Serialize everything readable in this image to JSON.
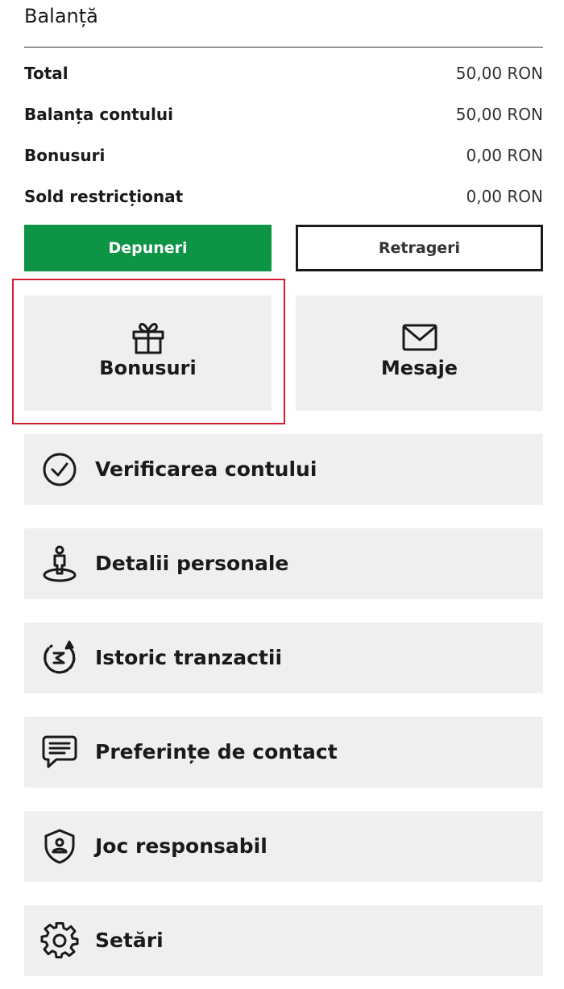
{
  "balance": {
    "title": "Balanță",
    "rows": [
      {
        "label": "Total",
        "value": "50,00 RON"
      },
      {
        "label": "Balanța contului",
        "value": "50,00 RON"
      },
      {
        "label": "Bonusuri",
        "value": "0,00 RON"
      },
      {
        "label": "Sold restricționat",
        "value": "0,00 RON"
      }
    ]
  },
  "actions": {
    "deposit_label": "Depuneri",
    "withdraw_label": "Retrageri",
    "deposit_color": "#0d9444"
  },
  "tiles": {
    "bonus": {
      "label": "Bonusuri",
      "icon": "gift-icon"
    },
    "messages": {
      "label": "Mesaje",
      "icon": "envelope-icon"
    }
  },
  "menu": {
    "items": [
      {
        "label": "Verificarea contului",
        "icon": "check-circle-icon"
      },
      {
        "label": "Detalii personale",
        "icon": "person-icon"
      },
      {
        "label": "Istoric tranzactii",
        "icon": "history-icon"
      },
      {
        "label": "Preferințe de contact",
        "icon": "chat-icon"
      },
      {
        "label": "Joc responsabil",
        "icon": "shield-user-icon"
      },
      {
        "label": "Setări",
        "icon": "gear-icon"
      }
    ]
  },
  "highlight_color": "#d21d2c"
}
